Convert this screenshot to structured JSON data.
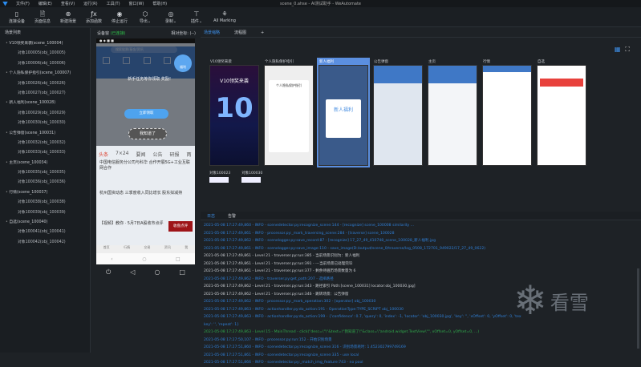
{
  "window": {
    "title": "scene_0.ahse - AI测试助手 - WeAutomate"
  },
  "menu": [
    "文件(F)",
    "编辑(E)",
    "查看(V)",
    "运行(R)",
    "工具(T)",
    "窗口(W)",
    "帮助(H)"
  ],
  "toolbar": [
    {
      "icon": "phone-icon",
      "glyph": "▯",
      "label": "连接设备"
    },
    {
      "icon": "page-info-icon",
      "glyph": "🗎",
      "label": "页面信息"
    },
    {
      "icon": "add-scene-icon",
      "glyph": "⊕",
      "label": "新建场景"
    },
    {
      "icon": "function-icon",
      "glyph": "ƒx",
      "label": "添加函数"
    },
    {
      "icon": "stop-icon",
      "glyph": "◉",
      "label": "停止运行"
    },
    {
      "icon": "export-icon",
      "glyph": "⬡",
      "label": "导出⌄"
    },
    {
      "icon": "record-icon",
      "glyph": "◎",
      "label": "录制⌄"
    },
    {
      "icon": "plugin-icon",
      "glyph": "⊤",
      "label": "插件⌄"
    },
    {
      "icon": "marking-icon",
      "glyph": "⚘",
      "label": "All Marking"
    }
  ],
  "sidebar": {
    "title": "场景列表",
    "scenes": [
      {
        "name": "V10领奖来袭(scene_100004)",
        "objects": [
          "对象100005(obj_100005)",
          "对象100006(obj_100006)"
        ]
      },
      {
        "name": "个人隐私保护指引(scene_100007)",
        "objects": [
          "对象100026(obj_100026)",
          "对象100027(obj_100027)"
        ]
      },
      {
        "name": "新人福利(scene_100028)",
        "objects": [
          "对象100029(obj_100029)",
          "对象100030(obj_100030)"
        ]
      },
      {
        "name": "公告弹窗(scene_100031)",
        "objects": [
          "对象100032(obj_100032)",
          "对象100033(obj_100033)"
        ]
      },
      {
        "name": "主页(scene_100034)",
        "objects": [
          "对象100035(obj_100035)",
          "对象100036(obj_100036)"
        ]
      },
      {
        "name": "行情(scene_100037)",
        "objects": [
          "对象100038(obj_100038)",
          "对象100039(obj_100039)"
        ]
      },
      {
        "name": "自选(scene_100040)",
        "objects": [
          "对象100041(obj_100041)",
          "对象100042(obj_100042)"
        ]
      }
    ]
  },
  "device": {
    "title": "设备窗",
    "status": "(已连接)",
    "coords_label": "相对坐标: (--)",
    "screen": {
      "search": "搜索股票/基金/资讯",
      "bubble": "福利",
      "hint": "新手任务等你领取\n奖励！",
      "btn1": "立即领取",
      "btn2": "我知道了",
      "tabs": [
        "头条",
        "7×24",
        "要闻",
        "公告",
        "研报",
        "两"
      ],
      "news": [
        "中国电信服务分公司与科华 合作开展5G+工业互联网合作",
        "杭州国资动态 三季度收入同比增长 股东拟减持"
      ],
      "ad_title": "【视频】教你 · 5月7日A股收市点评",
      "ad_btn": "收盘点评",
      "bottom_nav": [
        "首页",
        "行情",
        "交易",
        "资讯",
        "我"
      ]
    }
  },
  "tabs": [
    "场景缩略",
    "流程图",
    "+"
  ],
  "thumbnails": [
    {
      "label": "V10领奖来袭",
      "selected": false,
      "text": "V10领奖来袭"
    },
    {
      "label": "个人隐私保护指引",
      "selected": false,
      "text": "个人隐私保护指引"
    },
    {
      "label": "新人福利",
      "selected": true,
      "text": "新人福利"
    },
    {
      "label": "公告弹窗",
      "selected": false,
      "text": ""
    },
    {
      "label": "主页",
      "selected": false,
      "text": ""
    },
    {
      "label": "行情",
      "selected": false,
      "text": ""
    },
    {
      "label": "自选",
      "selected": false,
      "text": ""
    }
  ],
  "objects": [
    "对象100023",
    "对象100030"
  ],
  "log_tabs": [
    "日志",
    "告警"
  ],
  "log": [
    {
      "c": "info",
      "t": "2021-05-08 17:27:49,860 - INFO - scenedetector.py:recognize_scene:144 - [recognize] scene_100008 similarity ..."
    },
    {
      "c": "info",
      "t": "2021-05-08 17:27:49,861 - INFO - processor.py:_mark_traversing_scene:284 - [traverse] scene_100028"
    },
    {
      "c": "info",
      "t": "2021-05-08 17:27:49,862 - INFO - scenelogger.py:save_record:87 - [recognize] 17_27_49_410748_scene_100028_新人福利.jpg"
    },
    {
      "c": "info",
      "t": "2021-05-08 17:27:49,861 - INFO - scenelogger.py:save_image:110 - save_image(D:/output/scene_0/traverse/log_0508_172701_949022/17_27_49_0622)"
    },
    {
      "c": "lv",
      "t": "2021-05-08 17:27:49,861 - Level 21 - traverser.py:run:385 - 当前场景识别为：新人福利"
    },
    {
      "c": "lv",
      "t": "2021-05-08 17:27:49,861 - Level 21 - traverser.py:run:391 - ---当前场景已处理完毕"
    },
    {
      "c": "lv",
      "t": "2021-05-08 17:27:49,861 - Level 21 - traverser.py:run:377 - 剩余待遍历场景数量为 6"
    },
    {
      "c": "info",
      "t": "2021-05-08 17:27:49,862 - INFO - traverser.py:get_path:207 - 选择路径"
    },
    {
      "c": "lv",
      "t": "2021-05-08 17:27:49,862 - Level 21 - traverser.py:run:343 - 路径索引 Path:[scene_100031] locator:obj_100030.jpg]"
    },
    {
      "c": "lv",
      "t": "2021-05-08 17:27:49,862 - Level 21 - traverser.py:run:346 - 跳转场景：公告弹窗"
    },
    {
      "c": "info",
      "t": "2021-05-08 17:27:49,862 - INFO - processor.py:_mark_operation:302 - [operator] obj_100030"
    },
    {
      "c": "info",
      "t": "2021-05-08 17:27:49,863 - INFO - actionhandler.py:do_action:191 - OperationType:TYPE_SCRIPT obj_100030"
    },
    {
      "c": "info",
      "t": "2021-05-08 17:27:49,863 - INFO - actionhandler.py:do_action:199 - {'confidence': 0.7, 'query': 0, 'index': -1, 'locator': 'obj_100030.jpg', 'key': '', 'xOffset': 0, 'yOffset': 0, 'tex"
    },
    {
      "c": "info",
      "t": "key': '', 'repeat': 1}"
    },
    {
      "c": "ok",
      "t": "2021-05-08 17:27:49,863 - Level 15 - MainThread - click(\"desc=\\\"\\\"&text=\\\"我知道了\\\"&class=\\\"android.widget.TextView\\\"\", xOffset=0, yOffset=0, ...)"
    },
    {
      "c": "info",
      "t": "2021-05-08 17:27:50,107 - INFO - processor.py:run:152 - 开始识别场景"
    },
    {
      "c": "info",
      "t": "2021-05-08 17:27:51,860 - INFO - scenedetector.py:recognize_scene:316 - 识别场景耗时: 1.452302799749169"
    },
    {
      "c": "info",
      "t": "2021-05-08 17:27:51,861 - INFO - scenedetector.py:recognize_scene:335 - use local"
    },
    {
      "c": "info",
      "t": "2021-05-08 17:27:51,866 - INFO - scenedetector.py:_match_img_feature:743 - no pool"
    }
  ],
  "watermark": "看雪"
}
